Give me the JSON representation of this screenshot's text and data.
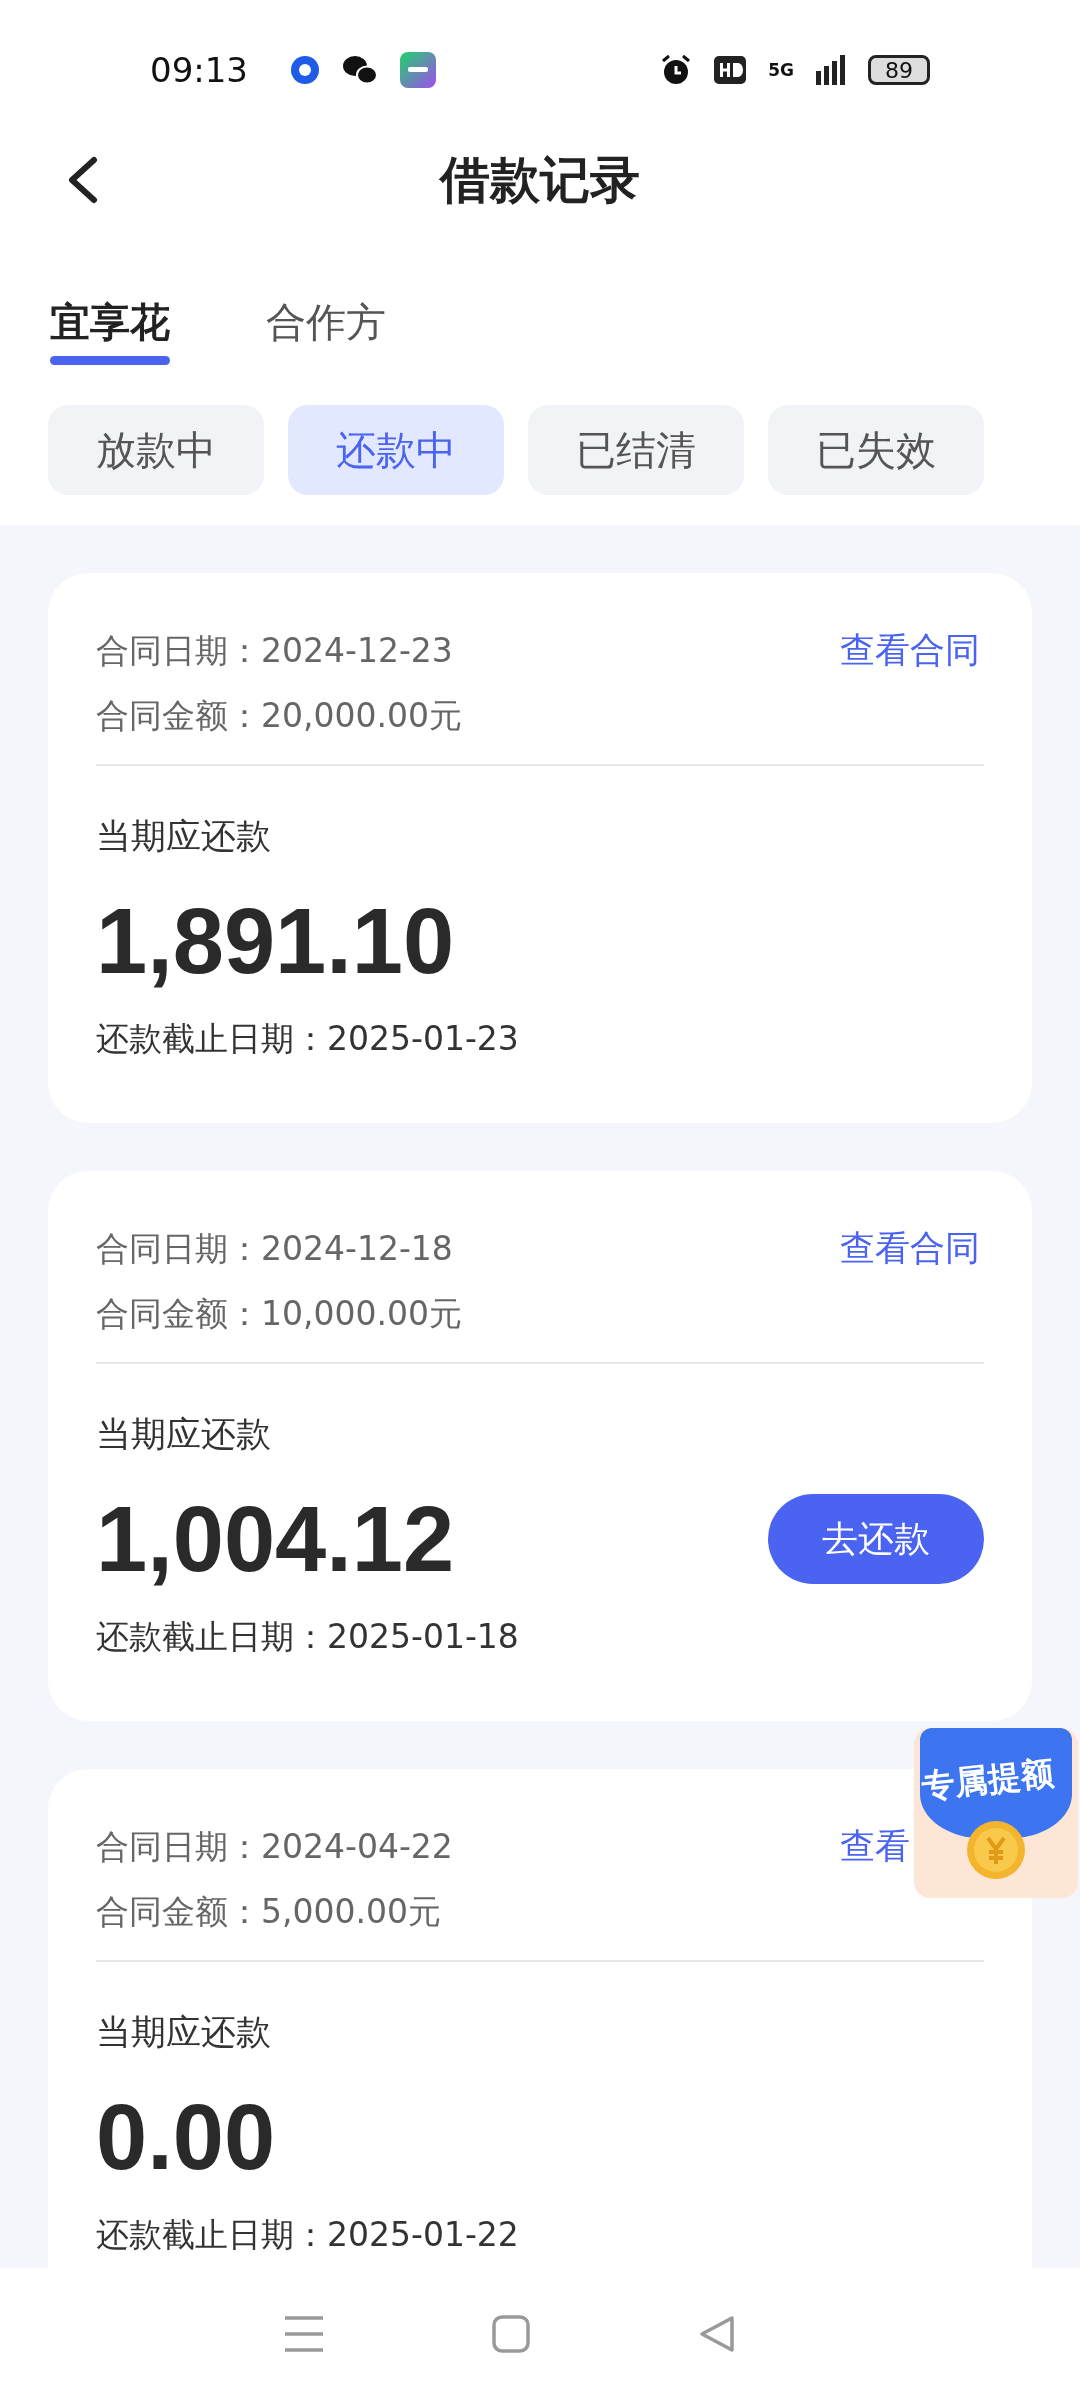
{
  "status_bar": {
    "time": "09:13",
    "battery": "89",
    "network": "5G"
  },
  "header": {
    "title": "借款记录"
  },
  "tabs": [
    {
      "label": "宜享花",
      "selected": true
    },
    {
      "label": "合作方",
      "selected": false
    }
  ],
  "filters": [
    {
      "label": "放款中",
      "selected": false
    },
    {
      "label": "还款中",
      "selected": true
    },
    {
      "label": "已结清",
      "selected": false
    },
    {
      "label": "已失效",
      "selected": false
    }
  ],
  "loans": [
    {
      "contract_date": "合同日期：2024-12-23",
      "contract_amount": "合同金额：20,000.00元",
      "link": "查看合同",
      "due_label": "当期应还款",
      "due_amount": "1,891.10",
      "deadline": "还款截止日期：2025-01-23"
    },
    {
      "contract_date": "合同日期：2024-12-18",
      "contract_amount": "合同金额：10,000.00元",
      "link": "查看合同",
      "due_label": "当期应还款",
      "due_amount": "1,004.12",
      "deadline": "还款截止日期：2025-01-18",
      "button": "去还款"
    },
    {
      "contract_date": "合同日期：2024-04-22",
      "contract_amount": "合同金额：5,000.00元",
      "link": "查看",
      "due_label": "当期应还款",
      "due_amount": "0.00",
      "deadline": "还款截止日期：2025-01-22"
    }
  ],
  "promo_badge": {
    "label": "专属提额"
  }
}
